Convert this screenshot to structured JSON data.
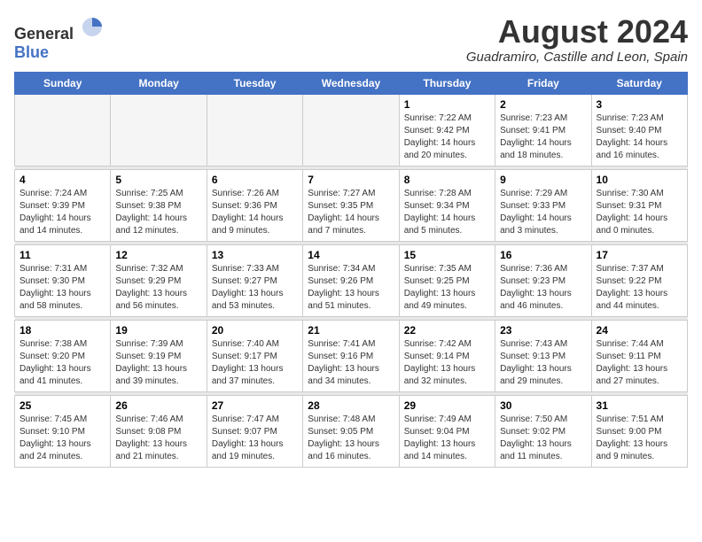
{
  "logo": {
    "text_general": "General",
    "text_blue": "Blue"
  },
  "title": {
    "month_year": "August 2024",
    "location": "Guadramiro, Castille and Leon, Spain"
  },
  "days_of_week": [
    "Sunday",
    "Monday",
    "Tuesday",
    "Wednesday",
    "Thursday",
    "Friday",
    "Saturday"
  ],
  "weeks": [
    [
      {
        "day": "",
        "info": ""
      },
      {
        "day": "",
        "info": ""
      },
      {
        "day": "",
        "info": ""
      },
      {
        "day": "",
        "info": ""
      },
      {
        "day": "1",
        "info": "Sunrise: 7:22 AM\nSunset: 9:42 PM\nDaylight: 14 hours\nand 20 minutes."
      },
      {
        "day": "2",
        "info": "Sunrise: 7:23 AM\nSunset: 9:41 PM\nDaylight: 14 hours\nand 18 minutes."
      },
      {
        "day": "3",
        "info": "Sunrise: 7:23 AM\nSunset: 9:40 PM\nDaylight: 14 hours\nand 16 minutes."
      }
    ],
    [
      {
        "day": "4",
        "info": "Sunrise: 7:24 AM\nSunset: 9:39 PM\nDaylight: 14 hours\nand 14 minutes."
      },
      {
        "day": "5",
        "info": "Sunrise: 7:25 AM\nSunset: 9:38 PM\nDaylight: 14 hours\nand 12 minutes."
      },
      {
        "day": "6",
        "info": "Sunrise: 7:26 AM\nSunset: 9:36 PM\nDaylight: 14 hours\nand 9 minutes."
      },
      {
        "day": "7",
        "info": "Sunrise: 7:27 AM\nSunset: 9:35 PM\nDaylight: 14 hours\nand 7 minutes."
      },
      {
        "day": "8",
        "info": "Sunrise: 7:28 AM\nSunset: 9:34 PM\nDaylight: 14 hours\nand 5 minutes."
      },
      {
        "day": "9",
        "info": "Sunrise: 7:29 AM\nSunset: 9:33 PM\nDaylight: 14 hours\nand 3 minutes."
      },
      {
        "day": "10",
        "info": "Sunrise: 7:30 AM\nSunset: 9:31 PM\nDaylight: 14 hours\nand 0 minutes."
      }
    ],
    [
      {
        "day": "11",
        "info": "Sunrise: 7:31 AM\nSunset: 9:30 PM\nDaylight: 13 hours\nand 58 minutes."
      },
      {
        "day": "12",
        "info": "Sunrise: 7:32 AM\nSunset: 9:29 PM\nDaylight: 13 hours\nand 56 minutes."
      },
      {
        "day": "13",
        "info": "Sunrise: 7:33 AM\nSunset: 9:27 PM\nDaylight: 13 hours\nand 53 minutes."
      },
      {
        "day": "14",
        "info": "Sunrise: 7:34 AM\nSunset: 9:26 PM\nDaylight: 13 hours\nand 51 minutes."
      },
      {
        "day": "15",
        "info": "Sunrise: 7:35 AM\nSunset: 9:25 PM\nDaylight: 13 hours\nand 49 minutes."
      },
      {
        "day": "16",
        "info": "Sunrise: 7:36 AM\nSunset: 9:23 PM\nDaylight: 13 hours\nand 46 minutes."
      },
      {
        "day": "17",
        "info": "Sunrise: 7:37 AM\nSunset: 9:22 PM\nDaylight: 13 hours\nand 44 minutes."
      }
    ],
    [
      {
        "day": "18",
        "info": "Sunrise: 7:38 AM\nSunset: 9:20 PM\nDaylight: 13 hours\nand 41 minutes."
      },
      {
        "day": "19",
        "info": "Sunrise: 7:39 AM\nSunset: 9:19 PM\nDaylight: 13 hours\nand 39 minutes."
      },
      {
        "day": "20",
        "info": "Sunrise: 7:40 AM\nSunset: 9:17 PM\nDaylight: 13 hours\nand 37 minutes."
      },
      {
        "day": "21",
        "info": "Sunrise: 7:41 AM\nSunset: 9:16 PM\nDaylight: 13 hours\nand 34 minutes."
      },
      {
        "day": "22",
        "info": "Sunrise: 7:42 AM\nSunset: 9:14 PM\nDaylight: 13 hours\nand 32 minutes."
      },
      {
        "day": "23",
        "info": "Sunrise: 7:43 AM\nSunset: 9:13 PM\nDaylight: 13 hours\nand 29 minutes."
      },
      {
        "day": "24",
        "info": "Sunrise: 7:44 AM\nSunset: 9:11 PM\nDaylight: 13 hours\nand 27 minutes."
      }
    ],
    [
      {
        "day": "25",
        "info": "Sunrise: 7:45 AM\nSunset: 9:10 PM\nDaylight: 13 hours\nand 24 minutes."
      },
      {
        "day": "26",
        "info": "Sunrise: 7:46 AM\nSunset: 9:08 PM\nDaylight: 13 hours\nand 21 minutes."
      },
      {
        "day": "27",
        "info": "Sunrise: 7:47 AM\nSunset: 9:07 PM\nDaylight: 13 hours\nand 19 minutes."
      },
      {
        "day": "28",
        "info": "Sunrise: 7:48 AM\nSunset: 9:05 PM\nDaylight: 13 hours\nand 16 minutes."
      },
      {
        "day": "29",
        "info": "Sunrise: 7:49 AM\nSunset: 9:04 PM\nDaylight: 13 hours\nand 14 minutes."
      },
      {
        "day": "30",
        "info": "Sunrise: 7:50 AM\nSunset: 9:02 PM\nDaylight: 13 hours\nand 11 minutes."
      },
      {
        "day": "31",
        "info": "Sunrise: 7:51 AM\nSunset: 9:00 PM\nDaylight: 13 hours\nand 9 minutes."
      }
    ]
  ]
}
